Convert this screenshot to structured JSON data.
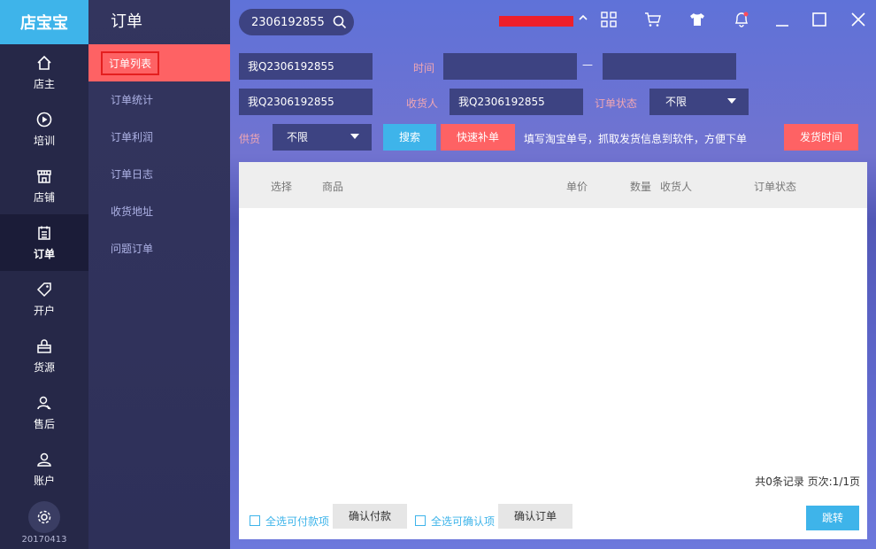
{
  "app": {
    "brand": "店宝宝",
    "version": "20170413"
  },
  "leftnav": [
    {
      "label": "店主",
      "icon": "home-icon"
    },
    {
      "label": "培训",
      "icon": "play-icon"
    },
    {
      "label": "店铺",
      "icon": "store-icon"
    },
    {
      "label": "订单",
      "icon": "order-icon",
      "active": true
    },
    {
      "label": "开户",
      "icon": "tag-icon"
    },
    {
      "label": "货源",
      "icon": "supply-icon"
    },
    {
      "label": "售后",
      "icon": "service-icon"
    },
    {
      "label": "账户",
      "icon": "user-icon"
    }
  ],
  "subnav": {
    "title": "订单",
    "items": [
      "订单列表",
      "订单统计",
      "订单利润",
      "订单日志",
      "收货地址",
      "问题订单"
    ]
  },
  "topbar": {
    "search_value": "2306192855"
  },
  "filters": {
    "order_no": "我Q2306192855",
    "time_label": "时间",
    "time_sep": "—",
    "buyer_value": "我Q2306192855",
    "receiver_label": "收货人",
    "receiver_value": "我Q2306192855",
    "status_label": "订单状态",
    "status_value": "不限",
    "supply_label": "供货",
    "supply_value": "不限",
    "search_btn": "搜索",
    "quick_btn": "快速补单",
    "hint": "填写淘宝单号，抓取发货信息到软件，方便下单",
    "ship_time_btn": "发货时间"
  },
  "table": {
    "columns": [
      "选择",
      "商品",
      "单价",
      "数量",
      "收货人",
      "订单状态"
    ],
    "page_info": "共0条记录 页次:1/1页",
    "footer": {
      "select_payable": "全选可付款项",
      "confirm_pay": "确认付款",
      "select_confirmable": "全选可确认项",
      "confirm_order": "确认订单",
      "goto": "跳转"
    }
  },
  "colors": {
    "accent": "#3eb4ea",
    "danger": "#fe6264",
    "sidebar": "#262848"
  }
}
